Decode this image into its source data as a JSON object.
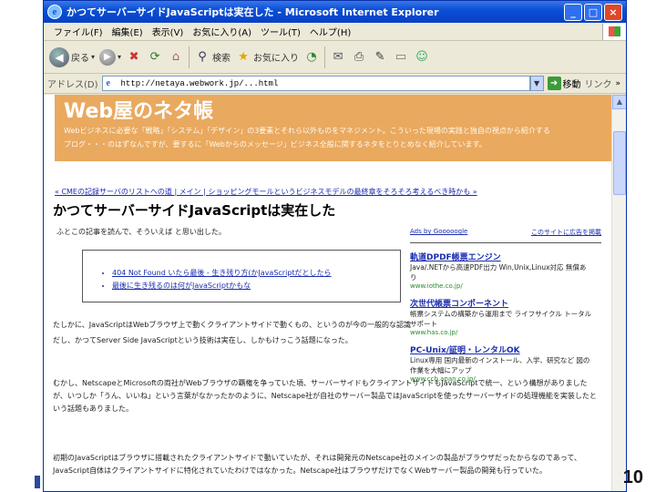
{
  "window": {
    "title": "かつてサーバーサイドJavaScriptは実在した - Microsoft Internet Explorer",
    "ie_glyph": "e",
    "min_glyph": "_",
    "max_glyph": "□",
    "close_glyph": "×"
  },
  "menu": [
    "ファイル(F)",
    "編集(E)",
    "表示(V)",
    "お気に入り(A)",
    "ツール(T)",
    "ヘルプ(H)"
  ],
  "toolbar": {
    "back_label": "戻る",
    "search_label": "検索",
    "favorites_label": "お気に入り"
  },
  "address": {
    "label": "アドレス(D)",
    "value": "http://netaya.webwork.jp/...html",
    "go_label": "移動",
    "links_label": "リンク"
  },
  "page": {
    "banner_title": "Web屋のネタ帳",
    "banner_desc_1": "Webビジネスに必要な「戦略」「システム」「デザイン」の3要素とそれら以外ものをマネジメント。こういった現場の実践と独自の視点から紹介する",
    "banner_desc_2": "ブログ・・・のはずなんですが、要するに「Webからのメッセージ」ビジネス全般に関するネタをとりとめなく紹介しています。",
    "breadcrumb": "« CMEの記録サーバのリストへの道 | メイン | ショッピングモールというビジネスモデルの最終章をそろそろ考えるべき時かも »",
    "article_title": "かつてサーバーサイドJavaScriptは実在した",
    "intro": "ふとこの記事を読んで、そういえば と思い出した。",
    "quote_items": [
      "404 Not Found いたら最後 - 生き残り方(かJavaScriptだとしたら",
      "最後に生き残るのは何がJavaScriptかもな"
    ],
    "ads_header_left": "Ads by Gooooogle",
    "ads_header_right": "このサイトに広告を掲載",
    "ads": [
      {
        "title": "軌道DPDF帳票エンジン",
        "desc": "Java/.NETから高速PDF出力 Win,Unix,Linux対応 無償あり",
        "url": "www.iothe.co.jp/"
      },
      {
        "title": "次世代帳票コンポーネント",
        "desc": "帳票システムの構築から運用まで ライフサイクル トータルサポート",
        "url": "www.has.co.jp/"
      },
      {
        "title": "PC-Unix/証明・レンタルOK",
        "desc": "Linux専用 国内最新のインストール、入学、研究など 図の作業を大幅にアップ",
        "url": "www.ccb.apan.co.jp/"
      }
    ],
    "para_1": "たしかに、JavaScriptはWebブラウザ上で動くクライアントサイドで動くもの、というのが今の一般的な認識だし、かつてServer Side JavaScriptという技術は実在し、しかもけっこう話題になった。",
    "para_2": "むかし、NetscapeとMicrosoftの両社がWebブラウザの覇権を争っていた頃、サーバーサイドもクライアントサイドもJavaScriptで統一、という構想がありましたが、いつしか「うん、いいね」という言葉がなかったかのように、Netscape社が自社のサーバー製品ではJavaScriptを使ったサーバーサイドの処理機能を実装したという話題もありました。",
    "para_3": "初期のJavaScriptはブラウザに搭載されたクライアントサイドで動いていたが、それは開発元のNetscape社のメインの製品がブラウザだったからなのであって、JavaScript自体はクライアントサイドに特化されていたわけではなかった。Netscape社はブラウザだけでなくWebサーバー製品の開発も行っていた。"
  },
  "slide_number": "10",
  "colors": {
    "banner": "#e9a95f",
    "titlebar": "#0a4fd6",
    "link": "#1a2cb0"
  }
}
